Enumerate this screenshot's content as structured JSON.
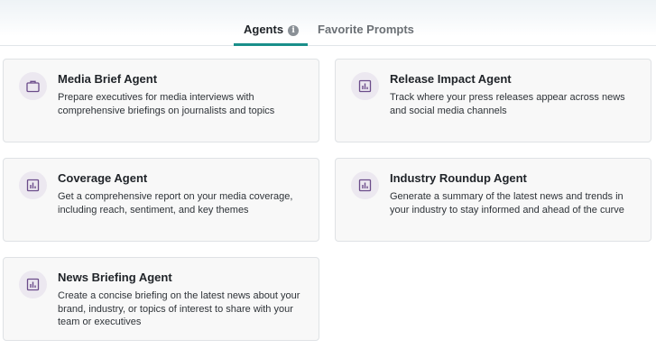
{
  "tabs": {
    "agents_label": "Agents",
    "favorites_label": "Favorite Prompts"
  },
  "colors": {
    "active_tab_underline": "#1a8f8a",
    "icon_color": "#6b4c8a",
    "icon_background": "#ece8f0"
  },
  "cards": [
    {
      "title": "Media Brief Agent",
      "description": "Prepare executives for media interviews with comprehensive briefings on journalists and topics",
      "icon": "briefcase-icon"
    },
    {
      "title": "Release Impact Agent",
      "description": "Track where your press releases appear across news and social media channels",
      "icon": "bar-chart-icon"
    },
    {
      "title": "Coverage Agent",
      "description": "Get a comprehensive report on your media coverage, including reach, sentiment, and key themes",
      "icon": "bar-chart-icon"
    },
    {
      "title": "Industry Roundup Agent",
      "description": "Generate a summary of the latest news and trends in your industry to stay informed and ahead of the curve",
      "icon": "bar-chart-icon"
    },
    {
      "title": "News Briefing Agent",
      "description": "Create a concise briefing on the latest news about your brand, industry, or topics of interest to share with your team or executives",
      "icon": "bar-chart-icon"
    }
  ]
}
